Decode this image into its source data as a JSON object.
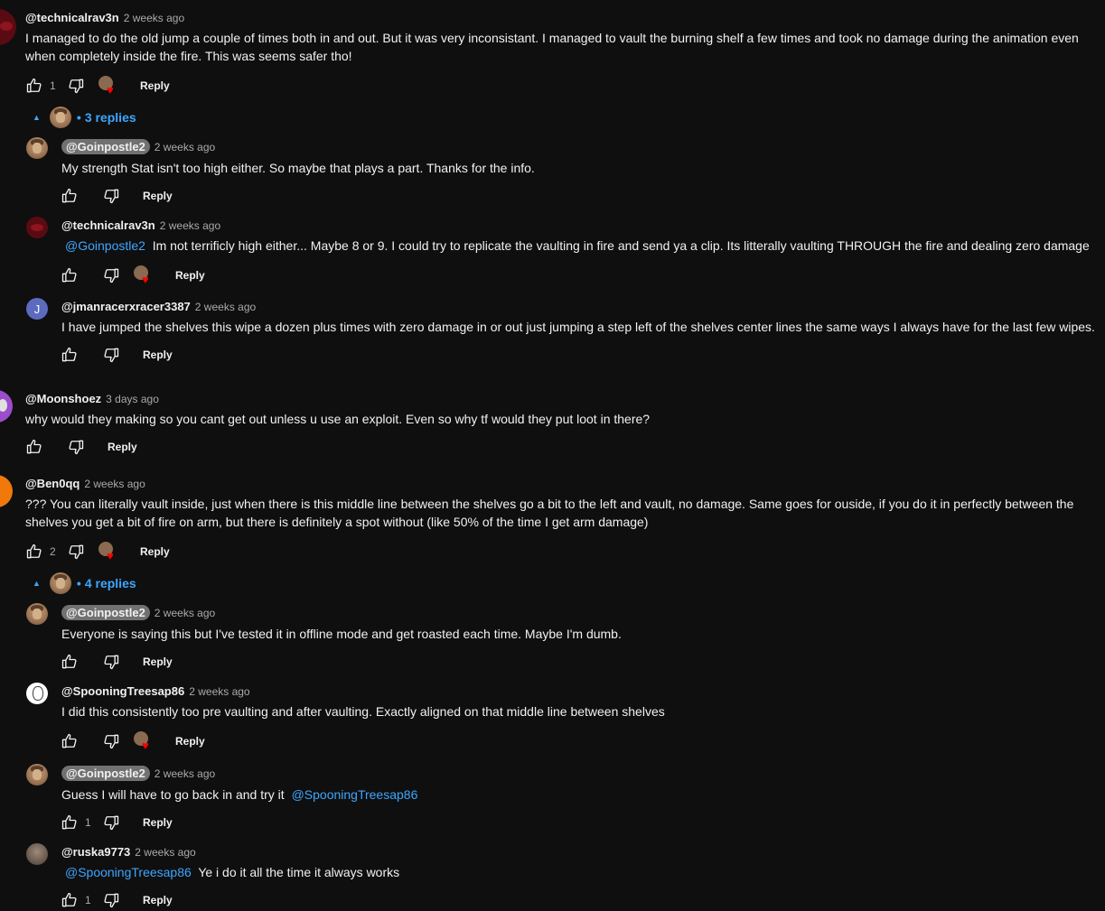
{
  "comments": [
    {
      "handle": "@technicalrav3n",
      "time": "2 weeks ago",
      "text": "I managed to do the old jump a couple of times both in and out. But it was very inconsistant. I managed to vault the burning shelf a few times and took no damage during the animation even when completely inside the fire. This was seems safer tho!",
      "likes": "1",
      "reply": "Reply",
      "replies_toggle": "3 replies",
      "replies": [
        {
          "handle": "@Goinpostle2",
          "time": "2 weeks ago",
          "text": "My strength Stat isn't too high either. So maybe that plays a part. Thanks for the info.",
          "likes": "",
          "reply": "Reply"
        },
        {
          "handle": "@technicalrav3n",
          "time": "2 weeks ago",
          "mention": "@Goinpostle2",
          "text": "Im not terrificly high either... Maybe 8 or 9. I could try to replicate the vaulting in fire and send ya a clip. Its litterally vaulting THROUGH the fire and dealing zero damage",
          "likes": "",
          "reply": "Reply"
        },
        {
          "handle": "@jmanracerxracer3387",
          "time": "2 weeks ago",
          "avatar_letter": "J",
          "text": "I have jumped the shelves this wipe a dozen plus times with zero damage in or out just jumping a step left of the shelves center lines the same ways I always have for the last few wipes.",
          "likes": "",
          "reply": "Reply"
        }
      ]
    },
    {
      "handle": "@Moonshoez",
      "time": "3 days ago",
      "text": "why would they making so you cant get out unless u use an exploit. Even so why tf would they put loot in there?",
      "likes": "",
      "reply": "Reply"
    },
    {
      "handle": "@Ben0qq",
      "time": "2 weeks ago",
      "text": "??? You can literally vault inside, just when there is this middle line between the shelves go a bit to the left and vault, no damage. Same goes for ouside, if you do it in perfectly between the shelves you get a bit of fire on arm, but there is definitely a spot without (like 50% of the time I get arm damage)",
      "likes": "2",
      "reply": "Reply",
      "replies_toggle": "4 replies",
      "replies": [
        {
          "handle": "@Goinpostle2",
          "time": "2 weeks ago",
          "text": "Everyone is saying this but I've tested it in offline mode and get roasted each time. Maybe I'm dumb.",
          "likes": "",
          "reply": "Reply"
        },
        {
          "handle": "@SpooningTreesap86",
          "time": "2 weeks ago",
          "text": "I did this consistently too pre vaulting and after vaulting. Exactly aligned on that middle line between shelves",
          "likes": "",
          "reply": "Reply"
        },
        {
          "handle": "@Goinpostle2",
          "time": "2 weeks ago",
          "text": "Guess I will have to go back in and try it ",
          "mention_after": "@SpooningTreesap86",
          "likes": "1",
          "reply": "Reply"
        },
        {
          "handle": "@ruska9773",
          "time": "2 weeks ago",
          "mention": "@SpooningTreesap86",
          "text": "Ye i do it all the time it always works",
          "likes": "1",
          "reply": "Reply"
        }
      ]
    }
  ],
  "colors": {
    "background": "#0f0f0f",
    "link": "#3ea6ff",
    "muted": "#aaaaaa",
    "heart": "#ff0000"
  },
  "icons": [
    "thumb-up-icon",
    "thumb-down-icon",
    "creator-heart-icon",
    "caret-up-icon"
  ]
}
